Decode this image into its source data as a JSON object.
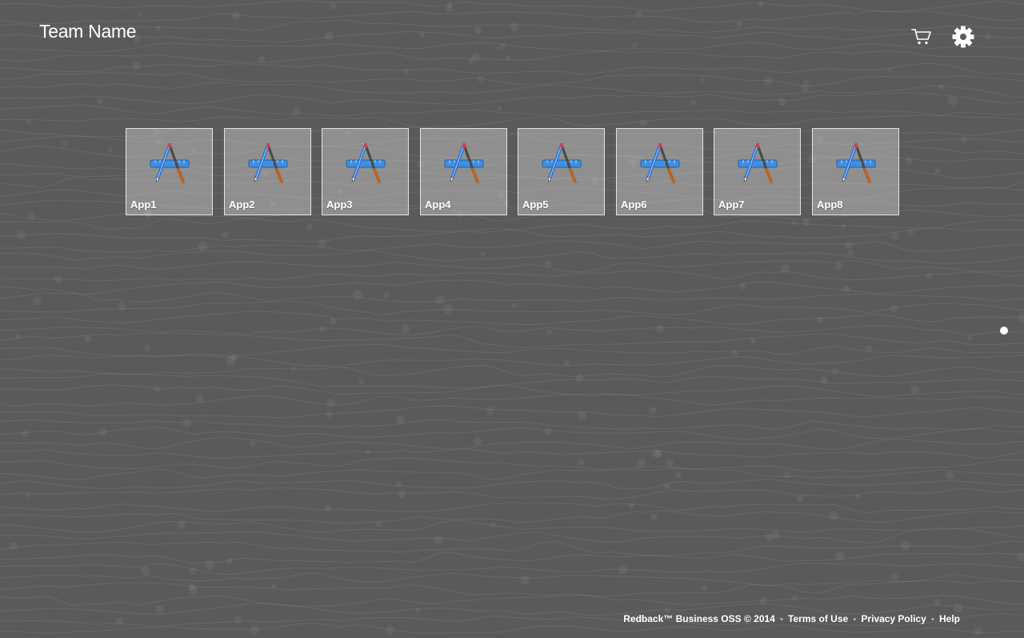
{
  "header": {
    "team_name": "Team Name",
    "cart_icon": "shopping-cart-icon",
    "settings_icon": "gear-icon"
  },
  "apps": [
    {
      "label": "App1",
      "icon": "xcode-app-icon"
    },
    {
      "label": "App2",
      "icon": "xcode-app-icon"
    },
    {
      "label": "App3",
      "icon": "xcode-app-icon"
    },
    {
      "label": "App4",
      "icon": "xcode-app-icon"
    },
    {
      "label": "App5",
      "icon": "xcode-app-icon"
    },
    {
      "label": "App6",
      "icon": "xcode-app-icon"
    },
    {
      "label": "App7",
      "icon": "xcode-app-icon"
    },
    {
      "label": "App8",
      "icon": "xcode-app-icon"
    }
  ],
  "pagination": {
    "pages": 1,
    "current": 1
  },
  "footer": {
    "copyright": "Redback™ Business OSS © 2014",
    "terms": "Terms of Use",
    "privacy": "Privacy Policy",
    "help": "Help",
    "separator": "•"
  },
  "colors": {
    "background": "#5a5a5a",
    "tile_fill": "rgba(255,255,255,0.32)",
    "text": "#ffffff"
  }
}
